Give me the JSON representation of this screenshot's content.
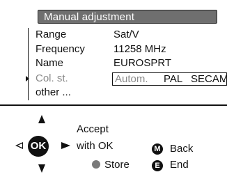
{
  "header": {
    "title": "Manual adjustment"
  },
  "menu": {
    "rows": [
      {
        "label": "Range",
        "value": "Sat/V"
      },
      {
        "label": "Frequency",
        "value": "11258 MHz"
      },
      {
        "label": "Name",
        "value": "EUROSPRT"
      },
      {
        "label": "Col. st.",
        "options": [
          "Autom.",
          "PAL",
          "SECAM",
          "."
        ]
      },
      {
        "label": "other ..."
      }
    ]
  },
  "controls": {
    "ok_key": "OK",
    "accept_line1": "Accept",
    "accept_line2": "with OK",
    "store_label": "Store",
    "back_key": "M",
    "back_label": "Back",
    "end_key": "E",
    "end_label": "End"
  },
  "colors": {
    "title_bar": "#6f6f6f",
    "dim_text": "#8a8a8a",
    "store_dot": "#7a7a7a"
  },
  "icons": [
    "selection-arrow-icon",
    "up-arrow-icon",
    "down-arrow-icon",
    "left-arrow-icon",
    "right-arrow-icon",
    "ok-key-icon",
    "store-dot-icon",
    "m-key-icon",
    "e-key-icon"
  ]
}
